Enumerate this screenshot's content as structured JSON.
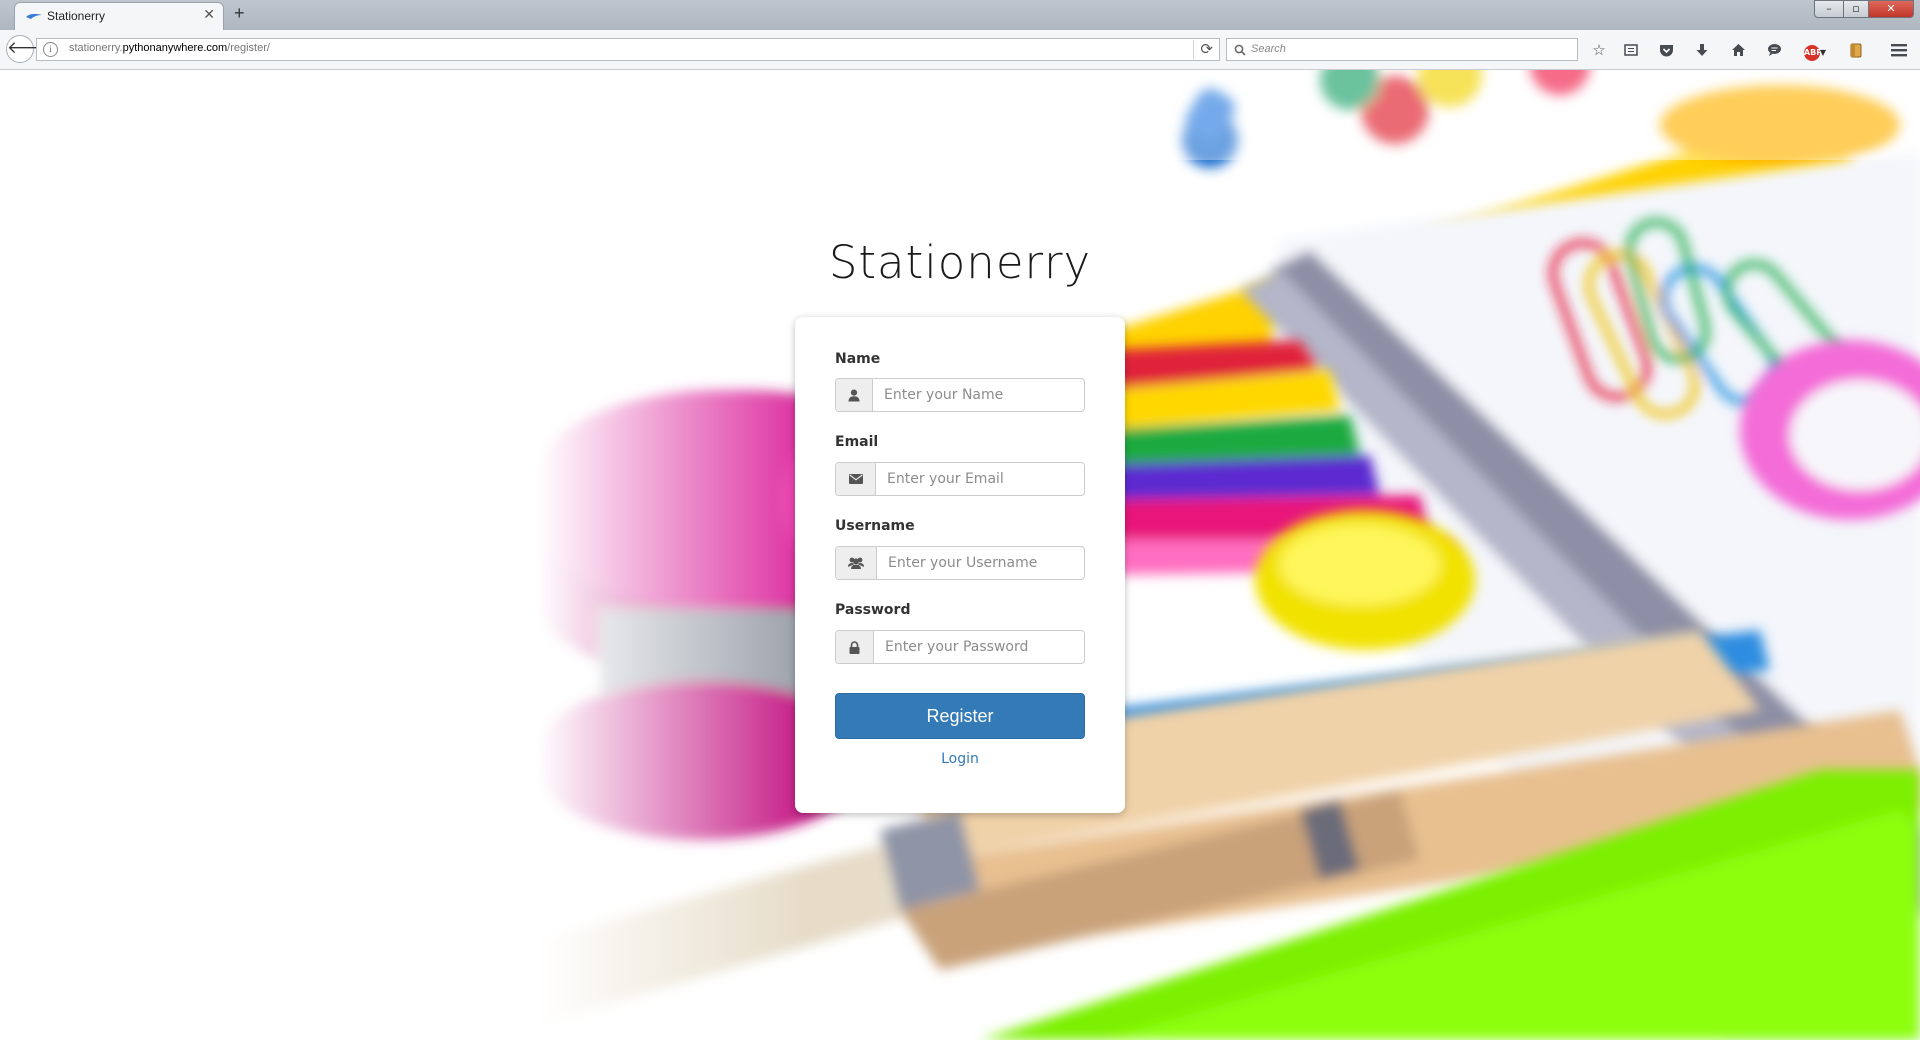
{
  "browser": {
    "tab_title": "Stationerry",
    "new_tab_symbol": "+",
    "url_prefix": "stationerry.",
    "url_host": "pythonanywhere.com",
    "url_path": "/register/",
    "search_placeholder": "Search",
    "window_controls": [
      "minimize",
      "maximize",
      "close"
    ],
    "toolbar_icons": [
      "star-icon",
      "reading-list-icon",
      "pocket-icon",
      "download-icon",
      "home-icon",
      "chat-icon",
      "adblock-icon",
      "extension-icon",
      "menu-icon"
    ],
    "adblock_badge": "ABP"
  },
  "page": {
    "brand": "Stationerry",
    "form": {
      "name_label": "Name",
      "name_placeholder": "Enter your Name",
      "email_label": "Email",
      "email_placeholder": "Enter your Email",
      "username_label": "Username",
      "username_placeholder": "Enter your Username",
      "password_label": "Password",
      "password_placeholder": "Enter your Password",
      "register_label": "Register",
      "login_label": "Login"
    },
    "colors": {
      "primary": "#337ab7",
      "addon_bg": "#eeeeee"
    }
  }
}
